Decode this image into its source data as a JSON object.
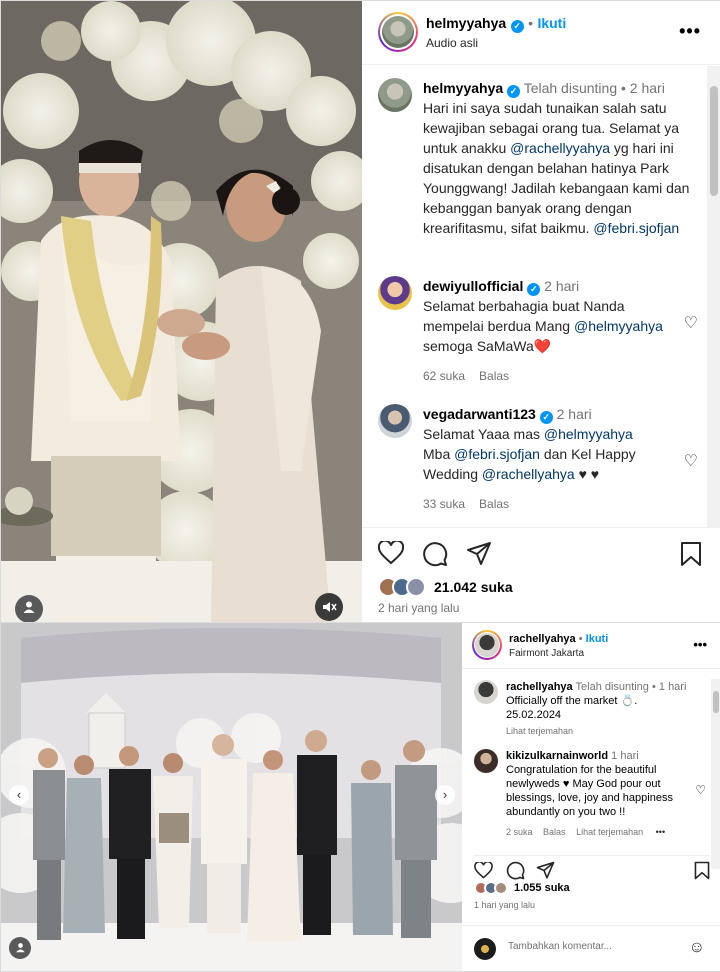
{
  "post1": {
    "header": {
      "username": "helmyyahya",
      "separator": "•",
      "follow_label": "Ikuti",
      "audio_label": "Audio asli",
      "more_icon": "more-horizontal-icon"
    },
    "caption": {
      "username": "helmyyahya",
      "edited": "Telah disunting",
      "separator": "•",
      "time": "2 hari",
      "text_1": "Hari ini saya sudah tunaikan salah satu kewajiban sebagai orang tua. Selamat ya untuk anakku ",
      "mention_1": "@rachellyyahya",
      "text_2": " yg hari ini disatukan dengan belahan hatinya Park Younggwang! Jadilah kebangaan kami dan kebanggan banyak orang dengan krearifitasmu, sifat baikmu. ",
      "mention_2": "@febri.sjofjan"
    },
    "comments": [
      {
        "username": "dewiyullofficial",
        "time": "2 hari",
        "text_1": "Selamat berbahagia buat Nanda mempelai berdua Mang ",
        "mention": "@helmyyahya",
        "text_2": " semoga SaMaWa",
        "emoji": "❤️",
        "likes": "62 suka",
        "reply": "Balas"
      },
      {
        "username": "vegadarwanti123",
        "time": "2 hari",
        "text_1": "Selamat Yaaa mas ",
        "mention_1": "@helmyyahya",
        "text_2": " Mba ",
        "mention_2": "@febri.sjofjan",
        "text_3": " dan Kel Happy Wedding ",
        "mention_3": "@rachellyahya",
        "text_4": " ♥ ♥",
        "likes": "33 suka",
        "reply": "Balas"
      }
    ],
    "likes": "21.042 suka",
    "time_ago": "2 hari yang lalu"
  },
  "post2": {
    "header": {
      "username": "rachellyahya",
      "separator": "•",
      "follow_label": "Ikuti",
      "location": "Fairmont Jakarta",
      "more_icon": "more-horizontal-icon"
    },
    "caption": {
      "username": "rachellyahya",
      "edited": "Telah disunting",
      "separator": "•",
      "time": "1 hari",
      "line_1": "Officially off the market 💍.",
      "line_2": "25.02.2024",
      "translate": "Lihat terjemahan"
    },
    "comment": {
      "username": "kikizulkarnainworld",
      "time": "1 hari",
      "text": "Congratulation for the beautiful newlyweds ♥ May God pour out blessings, love, joy and happiness abundantly on you two !!",
      "likes": "2 suka",
      "reply": "Balas",
      "translate": "Lihat terjemahan",
      "more": "•••"
    },
    "likes": "1.055 suka",
    "time_ago": "1 hari yang lalu",
    "comment_placeholder": "Tambahkan komentar..."
  },
  "colors": {
    "accent": "#0095f6",
    "link": "#00376b",
    "muted": "#737373",
    "like_red": "#ed4956"
  }
}
